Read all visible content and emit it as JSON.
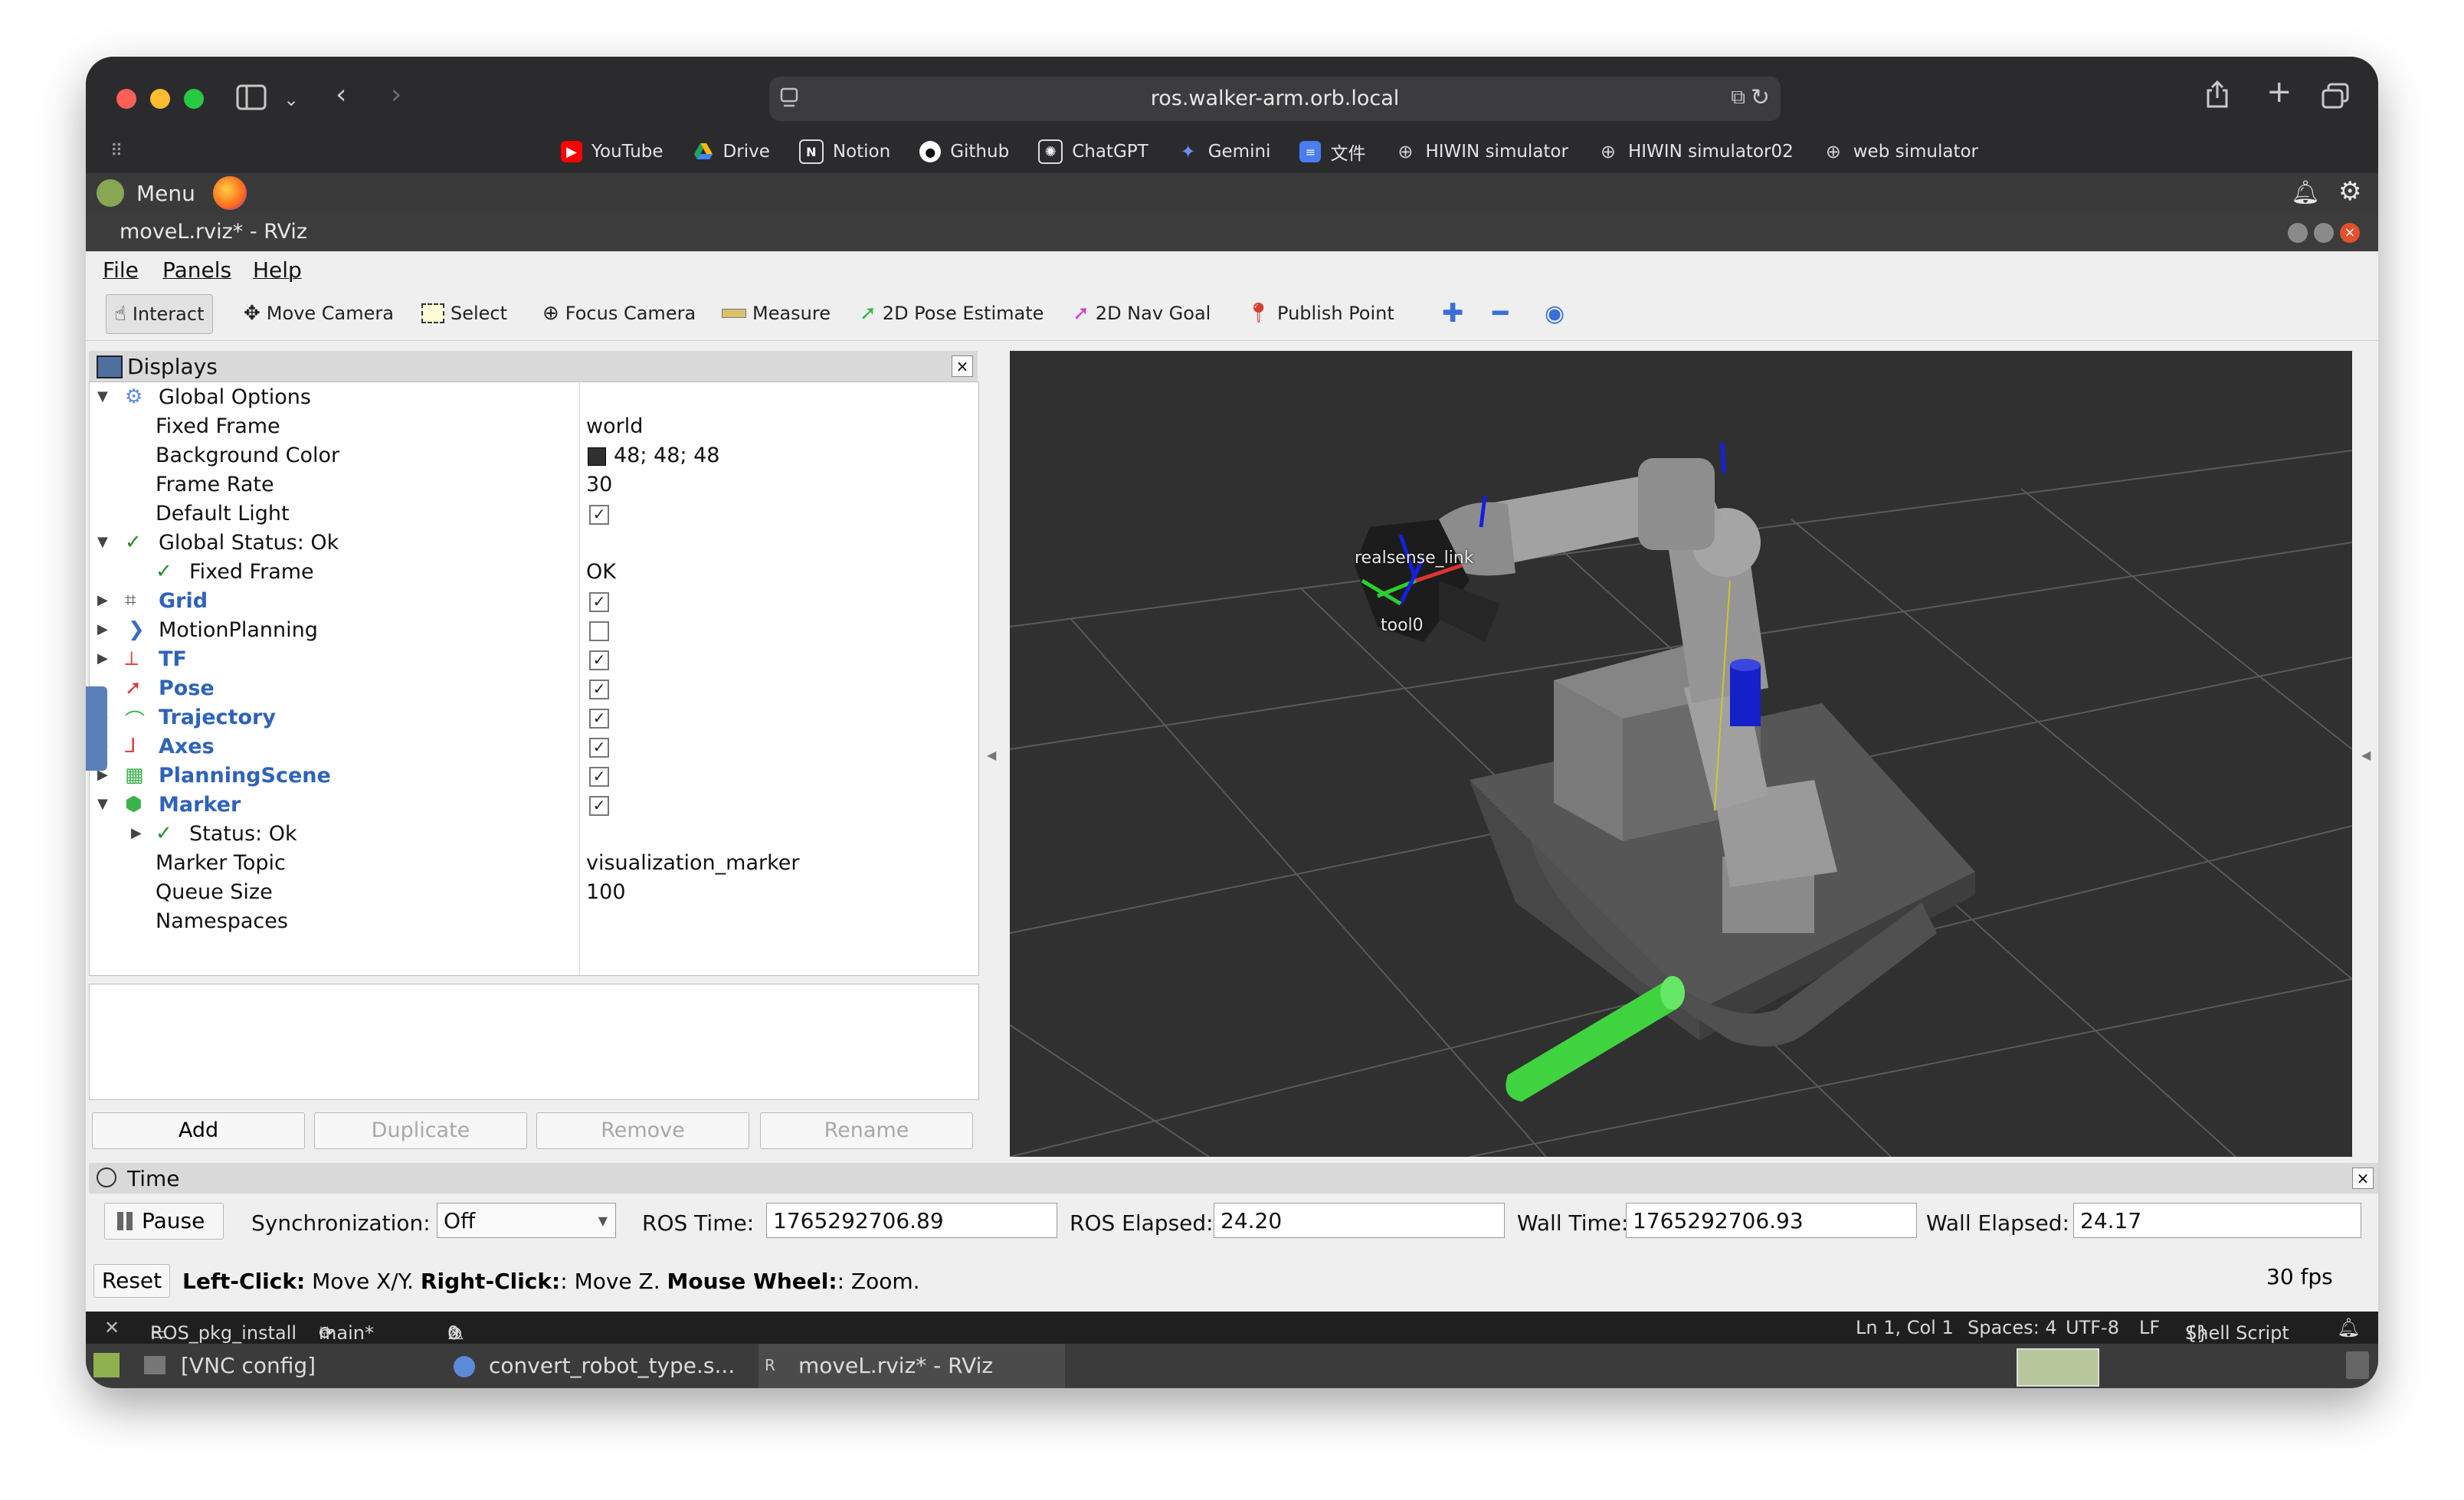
{
  "browser": {
    "url": "ros.walker-arm.orb.local",
    "bookmarks": [
      {
        "label": "YouTube",
        "icon": "youtube-icon",
        "color": "#ff0000"
      },
      {
        "label": "Drive",
        "icon": "drive-icon",
        "color": "#1fa463"
      },
      {
        "label": "Notion",
        "icon": "notion-icon",
        "color": "#ffffff"
      },
      {
        "label": "Github",
        "icon": "github-icon",
        "color": "#ffffff"
      },
      {
        "label": "ChatGPT",
        "icon": "chatgpt-icon",
        "color": "#ffffff"
      },
      {
        "label": "Gemini",
        "icon": "gemini-icon",
        "color": "#6b8cff"
      },
      {
        "label": "文件",
        "icon": "docs-icon",
        "color": "#4a7df0"
      },
      {
        "label": "HIWIN simulator",
        "icon": "globe-icon",
        "color": "#cfcfcf"
      },
      {
        "label": "HIWIN simulator02",
        "icon": "globe-icon",
        "color": "#cfcfcf"
      },
      {
        "label": "web simulator",
        "icon": "globe-icon",
        "color": "#cfcfcf"
      }
    ]
  },
  "desktop": {
    "menu_label": "Menu"
  },
  "window": {
    "title": "moveL.rviz* - RViz"
  },
  "menubar": {
    "file": "File",
    "panels": "Panels",
    "help": "Help"
  },
  "toolbar": {
    "interact": "Interact",
    "move_camera": "Move Camera",
    "select": "Select",
    "focus_camera": "Focus Camera",
    "measure": "Measure",
    "pose_estimate": "2D Pose Estimate",
    "nav_goal": "2D Nav Goal",
    "publish_point": "Publish Point"
  },
  "displays": {
    "title": "Displays",
    "global_options": "Global Options",
    "fixed_frame_label": "Fixed Frame",
    "fixed_frame_value": "world",
    "bg_color_label": "Background Color",
    "bg_color_value": "48; 48; 48",
    "frame_rate_label": "Frame Rate",
    "frame_rate_value": "30",
    "default_light_label": "Default Light",
    "global_status": "Global Status: Ok",
    "status_fixed_frame": "Fixed Frame",
    "status_fixed_frame_value": "OK",
    "grid": "Grid",
    "motion_planning": "MotionPlanning",
    "tf": "TF",
    "pose": "Pose",
    "trajectory": "Trajectory",
    "axes": "Axes",
    "planning_scene": "PlanningScene",
    "marker": "Marker",
    "marker_status": "Status: Ok",
    "marker_topic_label": "Marker Topic",
    "marker_topic_value": "visualization_marker",
    "queue_size_label": "Queue Size",
    "queue_size_value": "100",
    "namespaces_label": "Namespaces",
    "add": "Add",
    "duplicate": "Duplicate",
    "remove": "Remove",
    "rename": "Rename"
  },
  "scene": {
    "label_realsense": "realsense_link",
    "label_tool0": "tool0"
  },
  "time": {
    "title": "Time",
    "pause": "Pause",
    "sync_label": "Synchronization:",
    "sync_value": "Off",
    "ros_time_label": "ROS Time:",
    "ros_time_value": "1765292706.89",
    "ros_elapsed_label": "ROS Elapsed:",
    "ros_elapsed_value": "24.20",
    "wall_time_label": "Wall Time:",
    "wall_time_value": "1765292706.93",
    "wall_elapsed_label": "Wall Elapsed:",
    "wall_elapsed_value": "24.17"
  },
  "status": {
    "reset": "Reset",
    "left_click": "Left-Click:",
    "left_text": " Move X/Y. ",
    "right_click": "Right-Click:",
    "right_text": ": Move Z. ",
    "wheel": "Mouse Wheel:",
    "wheel_text": ": Zoom.",
    "fps": "30 fps"
  },
  "vscode": {
    "project": "ROS_pkg_install",
    "branch": "main*",
    "problems": "0",
    "warnings": "0",
    "position": "Ln 1, Col 1",
    "spaces": "Spaces: 4",
    "encoding": "UTF-8",
    "eol": "LF",
    "language": "Shell Script"
  },
  "taskbar": {
    "vnc_config": "[VNC config]",
    "convert": "convert_robot_type.s...",
    "rviz": "moveL.rviz* - RViz"
  }
}
